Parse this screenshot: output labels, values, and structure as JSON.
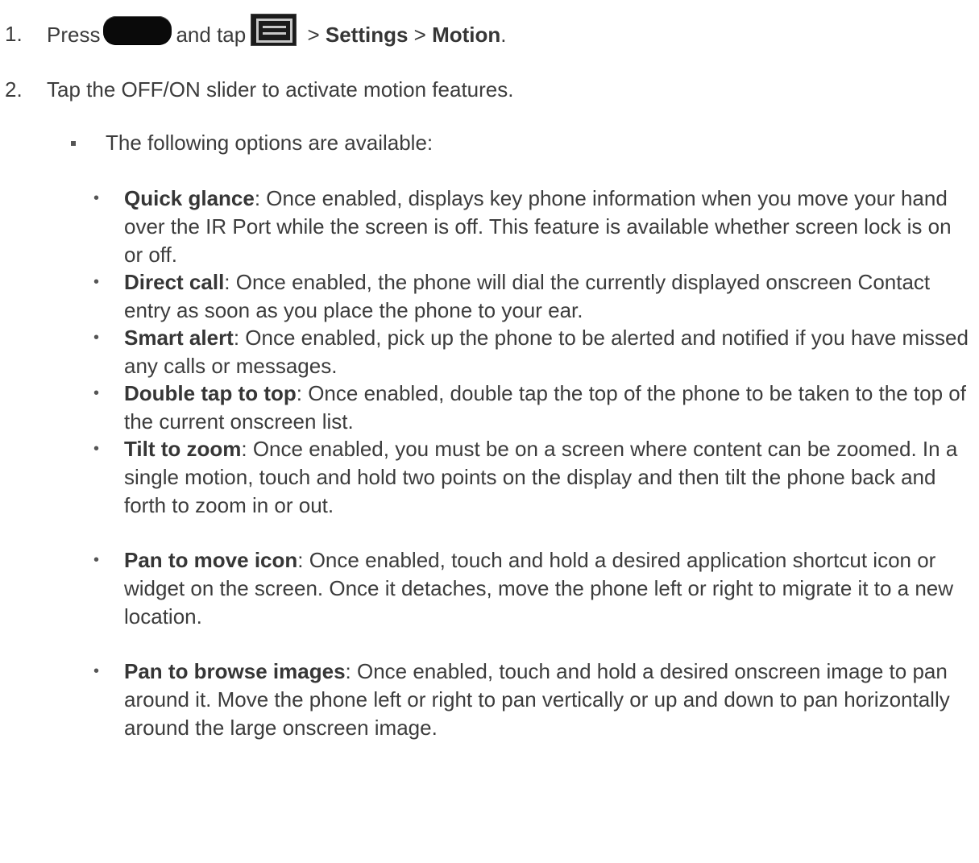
{
  "steps": [
    {
      "number": "1.",
      "press": "Press",
      "and_tap": "and tap",
      "sep1": " > ",
      "settings": "Settings",
      "sep2": " > ",
      "motion": "Motion",
      "end": ".",
      "icons": [
        "home-key-icon",
        "menu-key-icon"
      ]
    },
    {
      "number": "2.",
      "text": "Tap the OFF/ON slider to activate motion features."
    }
  ],
  "sub_bullet": "The following options are available:",
  "options": [
    {
      "name": "Quick glance",
      "desc": ": Once enabled, displays key phone information when you move your hand over the IR Port while the screen is off. This feature is available whether screen lock is on or off."
    },
    {
      "name": "Direct call",
      "desc": ": Once enabled, the phone will dial the currently displayed onscreen Contact entry as soon as you place the phone to your ear."
    },
    {
      "name": "Smart alert",
      "desc": ": Once enabled, pick up the phone to be alerted and notified if you have missed any calls or messages."
    },
    {
      "name": "Double tap to top",
      "desc": ": Once enabled, double tap the top of the phone to be taken to the top of the current onscreen list."
    },
    {
      "name": "Tilt to zoom",
      "desc": ": Once enabled, you must be on a screen where content can be zoomed. In a single motion, touch and hold two points on the display and then tilt the phone back and forth to zoom in or out."
    },
    {
      "name": "Pan to move icon",
      "desc": ": Once enabled, touch and hold a desired application shortcut icon or widget on the screen. Once it detaches, move the phone left or right to migrate it to a new location."
    },
    {
      "name": "Pan to browse images",
      "desc": ": Once enabled, touch and hold a desired onscreen image to pan around it. Move the phone left or right to pan vertically or up and down to pan horizontally around the large onscreen image."
    }
  ],
  "colors": {
    "text": "#3c3c3c",
    "icon_dark": "#0a0a0a",
    "icon_lines": "#c7c7c7"
  }
}
